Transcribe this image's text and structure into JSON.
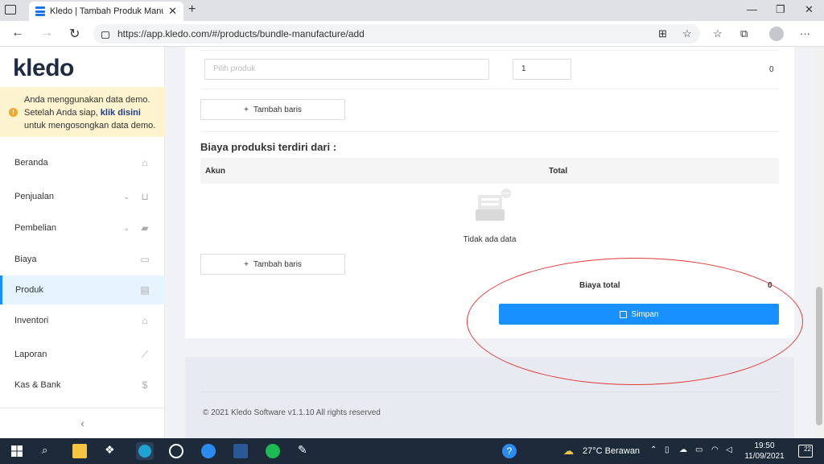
{
  "browser": {
    "tab_title": "Kledo | Tambah Produk Manufak",
    "url": "https://app.kledo.com/#/products/bundle-manufacture/add"
  },
  "sidebar": {
    "logo": "kledo",
    "demo_notice": {
      "line1": "Anda menggunakan data demo.",
      "line2_prefix": "Setelah Anda siap, ",
      "link": "klik disini",
      "line3": "untuk mengosongkan data demo."
    },
    "items": [
      {
        "label": "Beranda",
        "icon": "home-icon"
      },
      {
        "label": "Penjualan",
        "icon": "basket-icon",
        "expandable": true
      },
      {
        "label": "Pembelian",
        "icon": "bag-icon",
        "expandable": true
      },
      {
        "label": "Biaya",
        "icon": "card-icon"
      },
      {
        "label": "Produk",
        "icon": "box-icon",
        "active": true
      },
      {
        "label": "Inventori",
        "icon": "warehouse-icon"
      },
      {
        "label": "Laporan",
        "icon": "chart-icon"
      },
      {
        "label": "Kas & Bank",
        "icon": "dollar-icon"
      }
    ],
    "collapse_label": "‹"
  },
  "main": {
    "product_row": {
      "product_placeholder": "Pilih produk",
      "quantity": "1",
      "amount": "0"
    },
    "add_row_label": "Tambah baris",
    "production_costs_title": "Biaya produksi terdiri dari :",
    "table": {
      "columns": [
        "Akun",
        "Total"
      ],
      "empty_text": "Tidak ada data"
    },
    "total_label": "Biaya total",
    "total_value": "0",
    "save_label": "Simpan",
    "footer": "© 2021 Kledo Software v1.1.10 All rights reserved"
  },
  "taskbar": {
    "weather": "27°C  Berawan",
    "time": "19:50",
    "date": "11/09/2021",
    "notifications": "22"
  },
  "colors": {
    "primary": "#1890ff",
    "demo_bg": "#fdf3cf",
    "annotation": "#e53935"
  }
}
